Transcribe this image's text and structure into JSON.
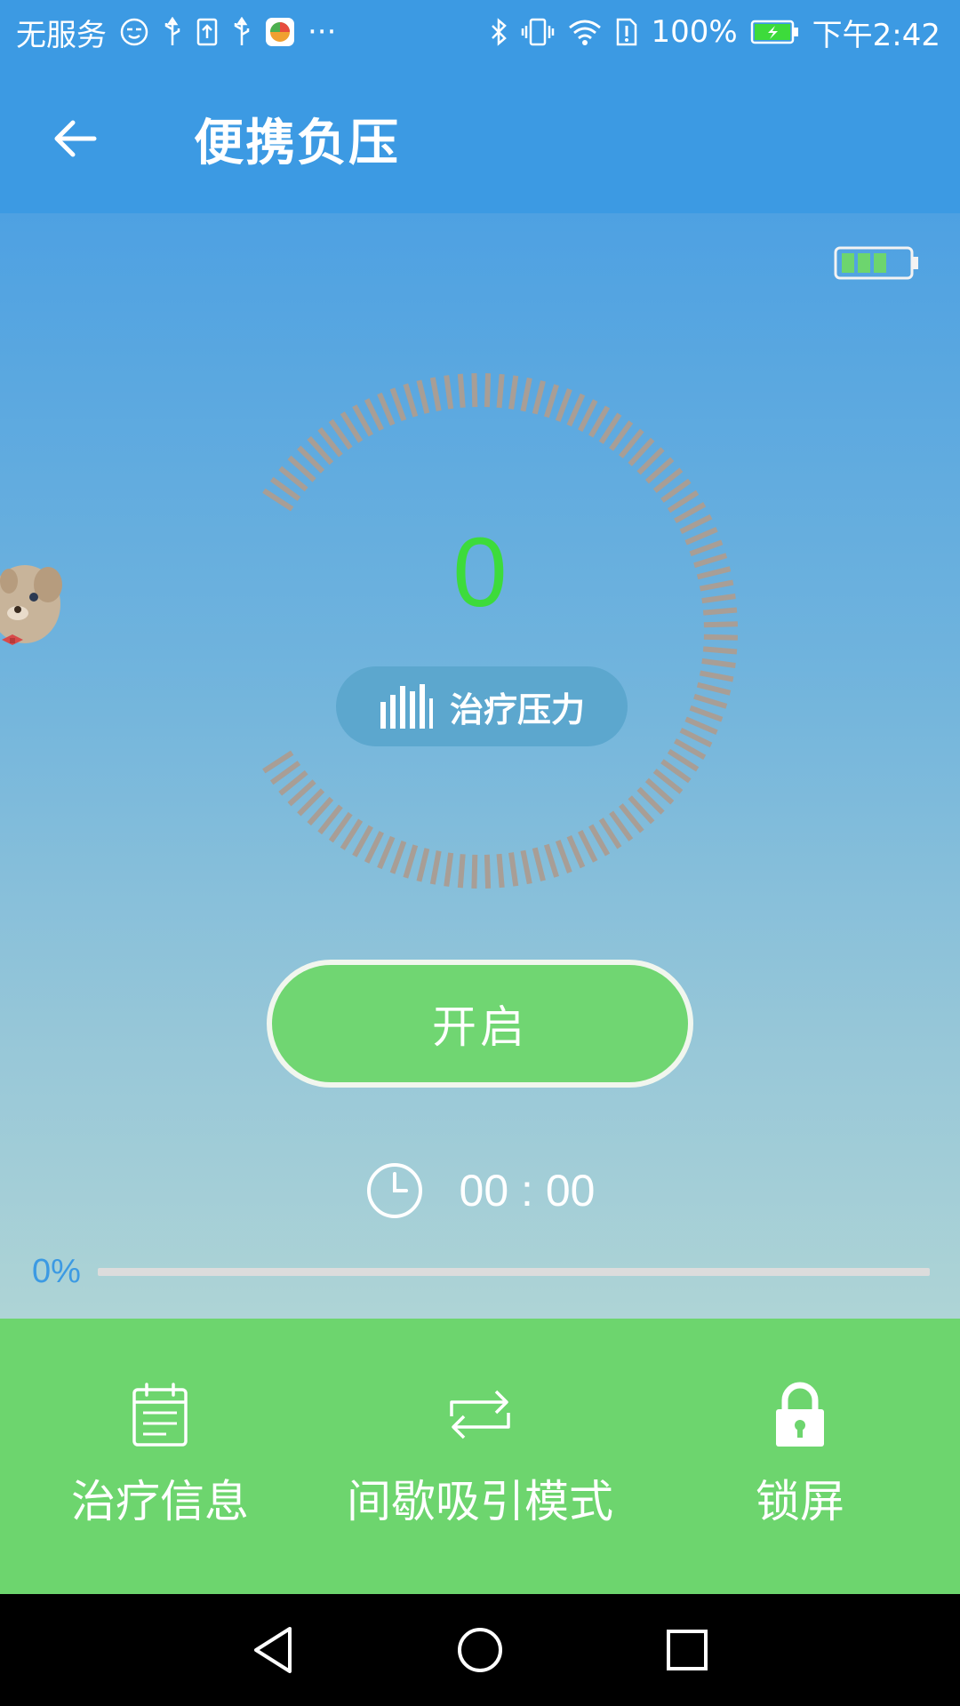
{
  "status_bar": {
    "carrier": "无服务",
    "battery_percent": "100%",
    "time": "下午2:42",
    "more_indicator": "···",
    "icons": [
      "smiley-icon",
      "usb-icon",
      "upload-icon",
      "usb-icon",
      "app-icon",
      "bluetooth-icon",
      "vibrate-icon",
      "wifi-icon",
      "sim-alert-icon",
      "battery-charging-icon"
    ]
  },
  "app_bar": {
    "title": "便携负压",
    "back_icon": "arrow-left-icon"
  },
  "device": {
    "battery_level": 1.0,
    "battery_color": "#6dd56e"
  },
  "gauge": {
    "value": "0",
    "value_color": "#3ddb3b",
    "label": "治疗压力",
    "label_icon": "bars-icon",
    "tick_color": "#a89e96"
  },
  "start_button": {
    "label": "开启"
  },
  "timer": {
    "icon": "clock-icon",
    "value": "00 : 00"
  },
  "progress": {
    "label": "0%",
    "value": 0
  },
  "tabs": [
    {
      "label": "治疗信息",
      "icon": "calendar-icon"
    },
    {
      "label": "间歇吸引模式",
      "icon": "repeat-icon"
    },
    {
      "label": "锁屏",
      "icon": "lock-icon"
    }
  ],
  "nav": {
    "back_icon": "triangle-back-icon",
    "home_icon": "circle-home-icon",
    "recent_icon": "square-recent-icon"
  },
  "colors": {
    "primary_blue": "#3c9ae3",
    "green": "#6dd56e",
    "track": "#dcdcdc"
  }
}
